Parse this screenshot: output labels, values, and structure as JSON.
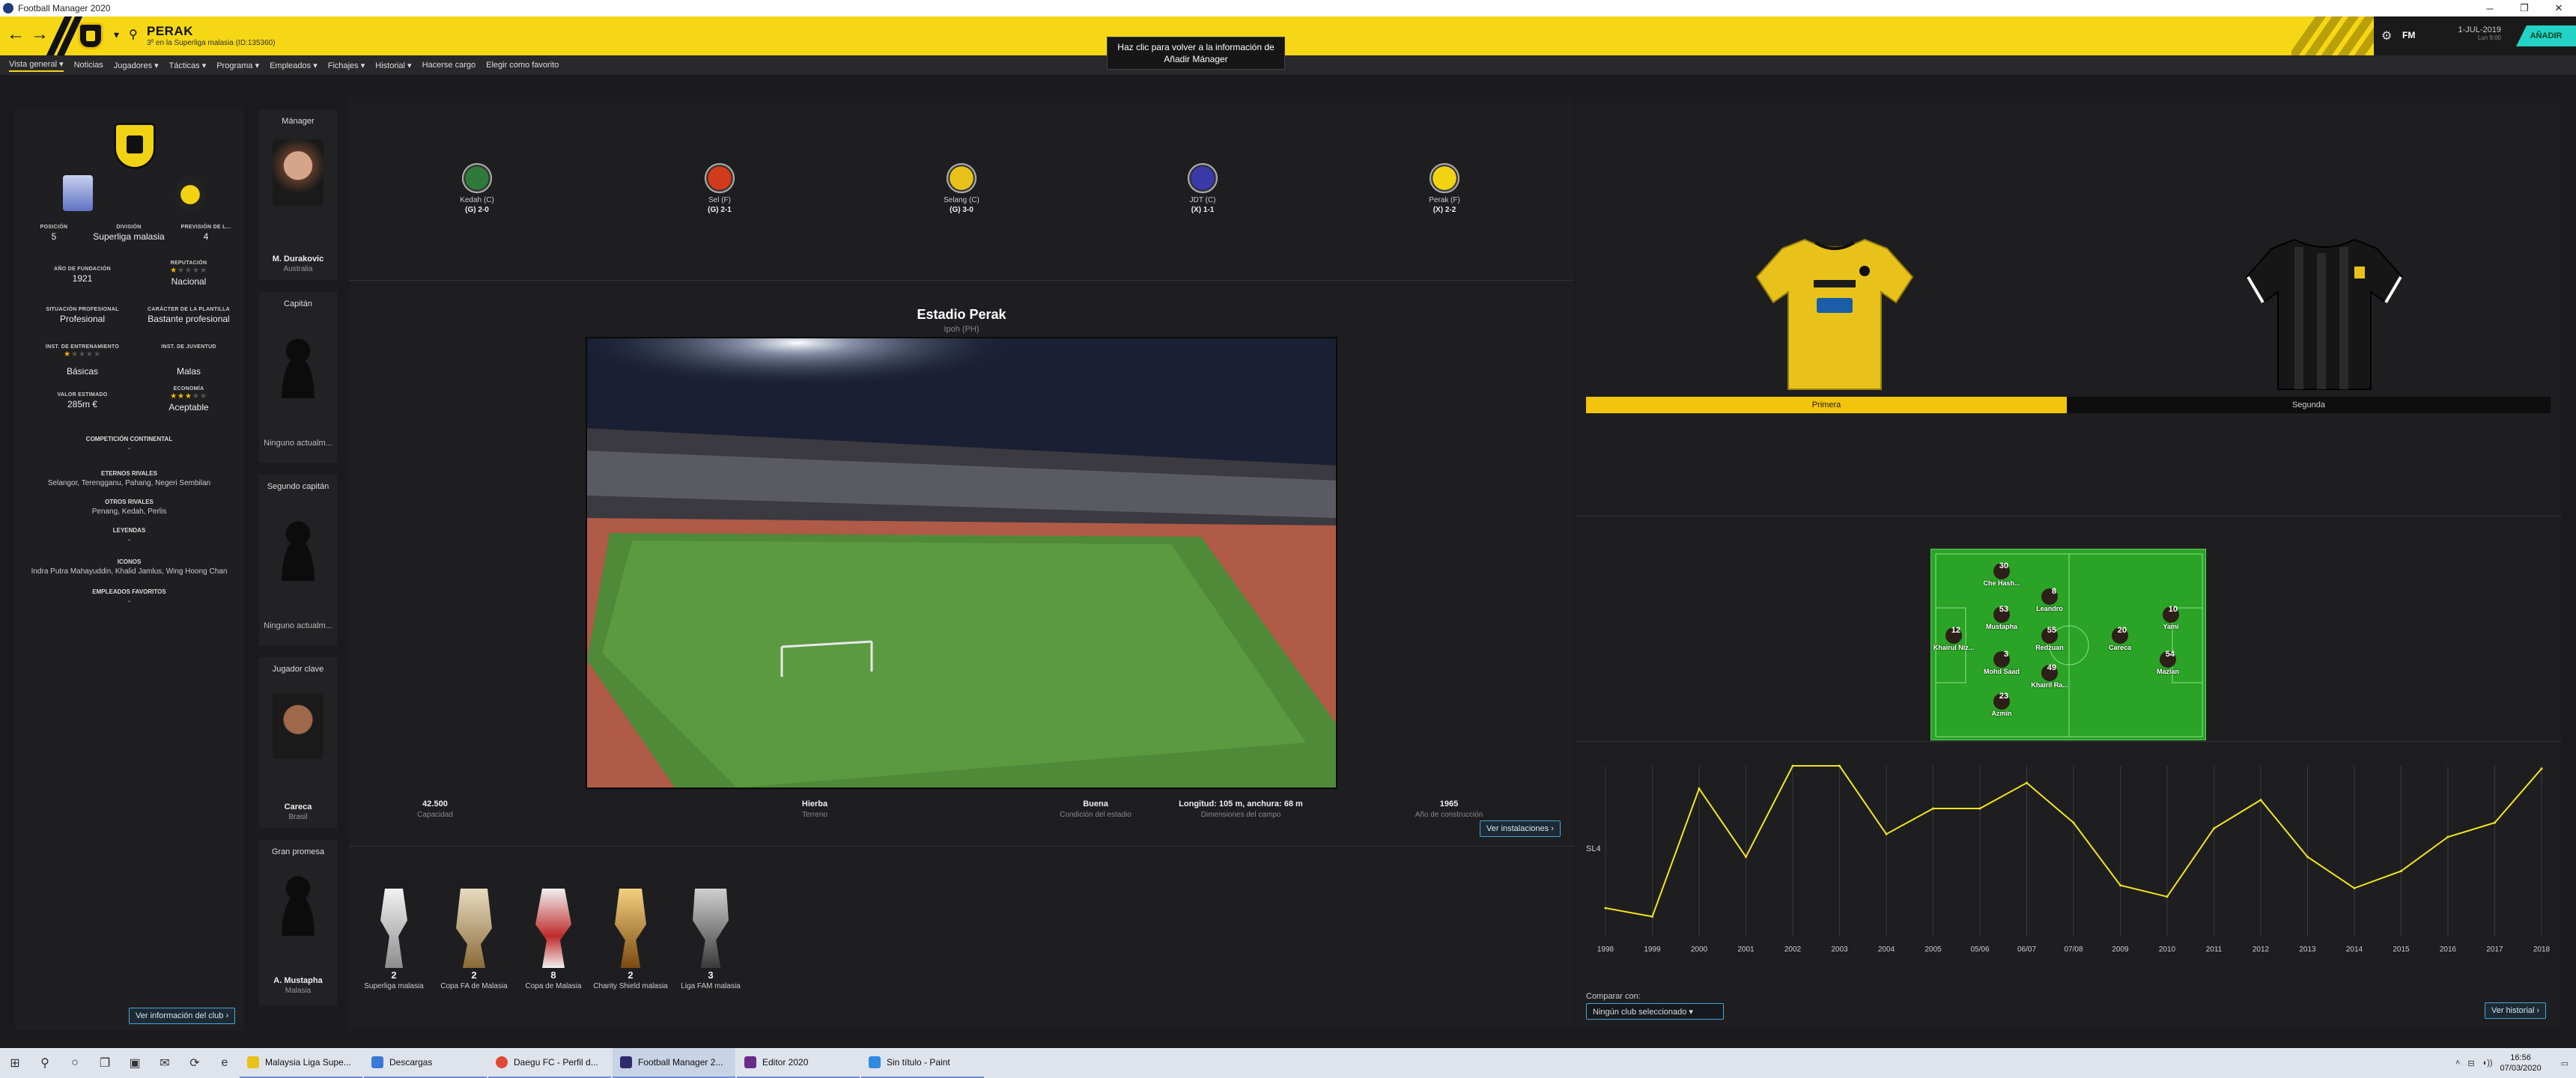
{
  "window": {
    "title": "Football Manager 2020",
    "controls": [
      "─",
      "❐",
      "✕"
    ]
  },
  "header": {
    "club_name": "PERAK",
    "club_subtitle": "3º en la Superliga malasia (ID:135360)",
    "date": "1-JUL-2019",
    "date_sub": "Lun 9:00",
    "fm_label": "FM",
    "add_button": "AÑADIR"
  },
  "tooltip": "Haz clic para volver a la información de Añadir Mánager",
  "subnav": [
    "Vista general",
    "Noticias",
    "Jugadores",
    "Tácticas",
    "Programa",
    "Empleados",
    "Fichajes",
    "Historial",
    "Hacerse cargo",
    "Elegir como favorito"
  ],
  "club_info": {
    "posicion_lbl": "POSICIÓN",
    "posicion": "5",
    "division_lbl": "DIVISIÓN",
    "division": "Superliga malasia",
    "prevision_lbl": "PREVISIÓN DE L...",
    "prevision": "4",
    "fundacion_lbl": "AÑO DE FUNDACIÓN",
    "fundacion": "1921",
    "reputacion_lbl": "REPUTACIÓN",
    "reputacion": "Nacional",
    "situacion_lbl": "SITUACIÓN PROFESIONAL",
    "situacion": "Profesional",
    "caracter_lbl": "CARÁCTER DE LA PLANTILLA",
    "caracter": "Bastante profesional",
    "entrenamiento_lbl": "INST. DE ENTRENAMIENTO",
    "entrenamiento": "Básicas",
    "juventud_lbl": "INST. DE JUVENTUD",
    "juventud": "Malas",
    "valor_lbl": "VALOR ESTIMADO",
    "valor": "285m €",
    "economia_lbl": "ECONOMÍA",
    "economia": "Aceptable",
    "competicion_lbl": "COMPETICIÓN CONTINENTAL",
    "competicion": "-",
    "eternos_lbl": "ETERNOS RIVALES",
    "eternos": "Selangor, Terengganu, Pahang, Negeri Sembilan",
    "otros_lbl": "OTROS RIVALES",
    "otros": "Penang, Kedah, Perlis",
    "leyendas_lbl": "LEYENDAS",
    "leyendas": "-",
    "iconos_lbl": "ICONOS",
    "iconos": "Indra Putra Mahayuddin, Khalid Jamlus, Wing Hoong Chan",
    "empleados_lbl": "EMPLEADOS FAVORITOS",
    "empleados": "-",
    "ver_info_btn": "Ver información del club",
    "stars": {
      "reputacion": 1,
      "entrenamiento": 1,
      "economia": 3
    }
  },
  "people": {
    "manager_role": "Mánager",
    "manager_name": "M. Durakovic",
    "manager_nat": "Australia",
    "captain_role": "Capitán",
    "captain_none": "Ninguno actualm...",
    "vice_role": "Segundo capitán",
    "vice_none": "Ninguno actualm...",
    "key_role": "Jugador clave",
    "key_name": "Careca",
    "key_nat": "Brasil",
    "prospect_role": "Gran promesa",
    "prospect_name": "A. Mustapha",
    "prospect_nat": "Malasia"
  },
  "results": [
    {
      "team": "Kedah (C)",
      "score": "(G) 2-0",
      "color": "#2f7a3a"
    },
    {
      "team": "Sel (F)",
      "score": "(G) 2-1",
      "color": "#d23a1c"
    },
    {
      "team": "Selang (C)",
      "score": "(G) 3-0",
      "color": "#e8c21a"
    },
    {
      "team": "JDT (C)",
      "score": "(X) 1-1",
      "color": "#3a3aa8"
    },
    {
      "team": "Perak (F)",
      "score": "(X) 2-2",
      "color": "#f2d313"
    }
  ],
  "stadium": {
    "name": "Estadio Perak",
    "city": "Ipoh (PH)",
    "capacidad": "42.500",
    "capacidad_lbl": "Capacidad",
    "terreno": "Hierba",
    "terreno_lbl": "Terreno",
    "condicion": "Buena",
    "condicion_lbl": "Condición del estadio",
    "dimensiones": "Longitud: 105 m, anchura: 68 m",
    "dimensiones_lbl": "Dimensiones del campo",
    "anio": "1965",
    "anio_lbl": "Año de construcción",
    "ver_btn": "Ver instalaciones"
  },
  "trophies": [
    {
      "count": "2",
      "name": "Superliga malasia"
    },
    {
      "count": "2",
      "name": "Copa FA de Malasia"
    },
    {
      "count": "8",
      "name": "Copa de Malasia"
    },
    {
      "count": "2",
      "name": "Charity Shield malasia"
    },
    {
      "count": "3",
      "name": "Liga FAM malasia"
    }
  ],
  "kits": {
    "primera": "Primera",
    "segunda": "Segunda",
    "primary_color": "#e8c21a",
    "secondary_color": "#111111"
  },
  "lineup": [
    {
      "num": "30",
      "name": "Che Hash..."
    },
    {
      "num": "8",
      "name": "Leandro"
    },
    {
      "num": "53",
      "name": "Mustapha"
    },
    {
      "num": "10",
      "name": "Yami"
    },
    {
      "num": "12",
      "name": "Khairul Niz..."
    },
    {
      "num": "55",
      "name": "Redzuan"
    },
    {
      "num": "20",
      "name": "Careca"
    },
    {
      "num": "3",
      "name": "Mohd Saad"
    },
    {
      "num": "54",
      "name": "Mazlan"
    },
    {
      "num": "49",
      "name": "Khairil Ra..."
    },
    {
      "num": "23",
      "name": "Azmin"
    }
  ],
  "chart_data": {
    "type": "line",
    "x": [
      "1998",
      "1999",
      "2000",
      "2001",
      "2002",
      "2003",
      "2004",
      "2005",
      "05/06",
      "06/07",
      "07/08",
      "2009",
      "2010",
      "2011",
      "2012",
      "2013",
      "2014",
      "2015",
      "2016",
      "2017",
      "2018"
    ],
    "values": [
      6,
      6.3,
      1.8,
      4.2,
      1,
      1,
      3.4,
      2.5,
      2.5,
      1.6,
      3,
      5.2,
      5.6,
      3.2,
      2.2,
      4.2,
      5.3,
      4.7,
      3.5,
      3,
      1.1
    ],
    "ylabel": "SL4",
    "y_inverted": true,
    "ylim": [
      1,
      7
    ],
    "line_color": "#f2e51e",
    "compare_lbl": "Comparar con:",
    "compare_value": "Ningún club seleccionado",
    "ver_historial_btn": "Ver historial"
  },
  "taskbar": {
    "apps": [
      {
        "label": "Malaysia Liga Supe...",
        "color": "#e8c21a"
      },
      {
        "label": "Descargas",
        "color": "#3b78d8"
      },
      {
        "label": "Daegu FC - Perfil d...",
        "color": "#de4a36"
      },
      {
        "label": "Football Manager 2...",
        "color": "#2f2a6a"
      },
      {
        "label": "Editor 2020",
        "color": "#6a2a8a"
      },
      {
        "label": "Sin título - Paint",
        "color": "#2f8ae0"
      }
    ],
    "time": "16:56",
    "date": "07/03/2020"
  }
}
